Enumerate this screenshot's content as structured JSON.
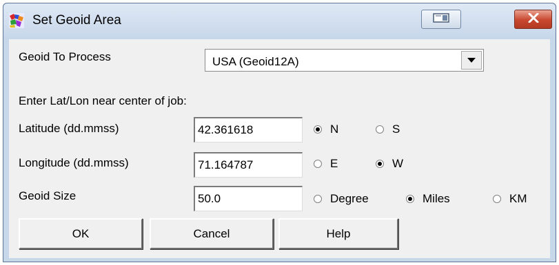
{
  "window": {
    "title": "Set Geoid Area",
    "app_icon": "geoid-app-icon",
    "controls": {
      "restore_icon": "restore-icon",
      "close_icon": "close-x-icon"
    }
  },
  "geoid": {
    "label": "Geoid To Process",
    "selected": "USA (Geoid12A)",
    "dropdown_icon": "triangle-down-icon"
  },
  "instructions": "Enter Lat/Lon near center of job:",
  "latitude": {
    "label": "Latitude (dd.mmss)",
    "value": "42.361618",
    "options": [
      {
        "label": "N",
        "checked": true
      },
      {
        "label": "S",
        "checked": false
      }
    ]
  },
  "longitude": {
    "label": "Longitude (dd.mmss)",
    "value": "71.164787",
    "options": [
      {
        "label": "E",
        "checked": false
      },
      {
        "label": "W",
        "checked": true
      }
    ]
  },
  "size": {
    "label": "Geoid Size",
    "value": "50.0",
    "options": [
      {
        "label": "Degree",
        "checked": false
      },
      {
        "label": "Miles",
        "checked": true
      },
      {
        "label": "KM",
        "checked": false
      }
    ]
  },
  "buttons": {
    "ok": "OK",
    "cancel": "Cancel",
    "help": "Help"
  }
}
